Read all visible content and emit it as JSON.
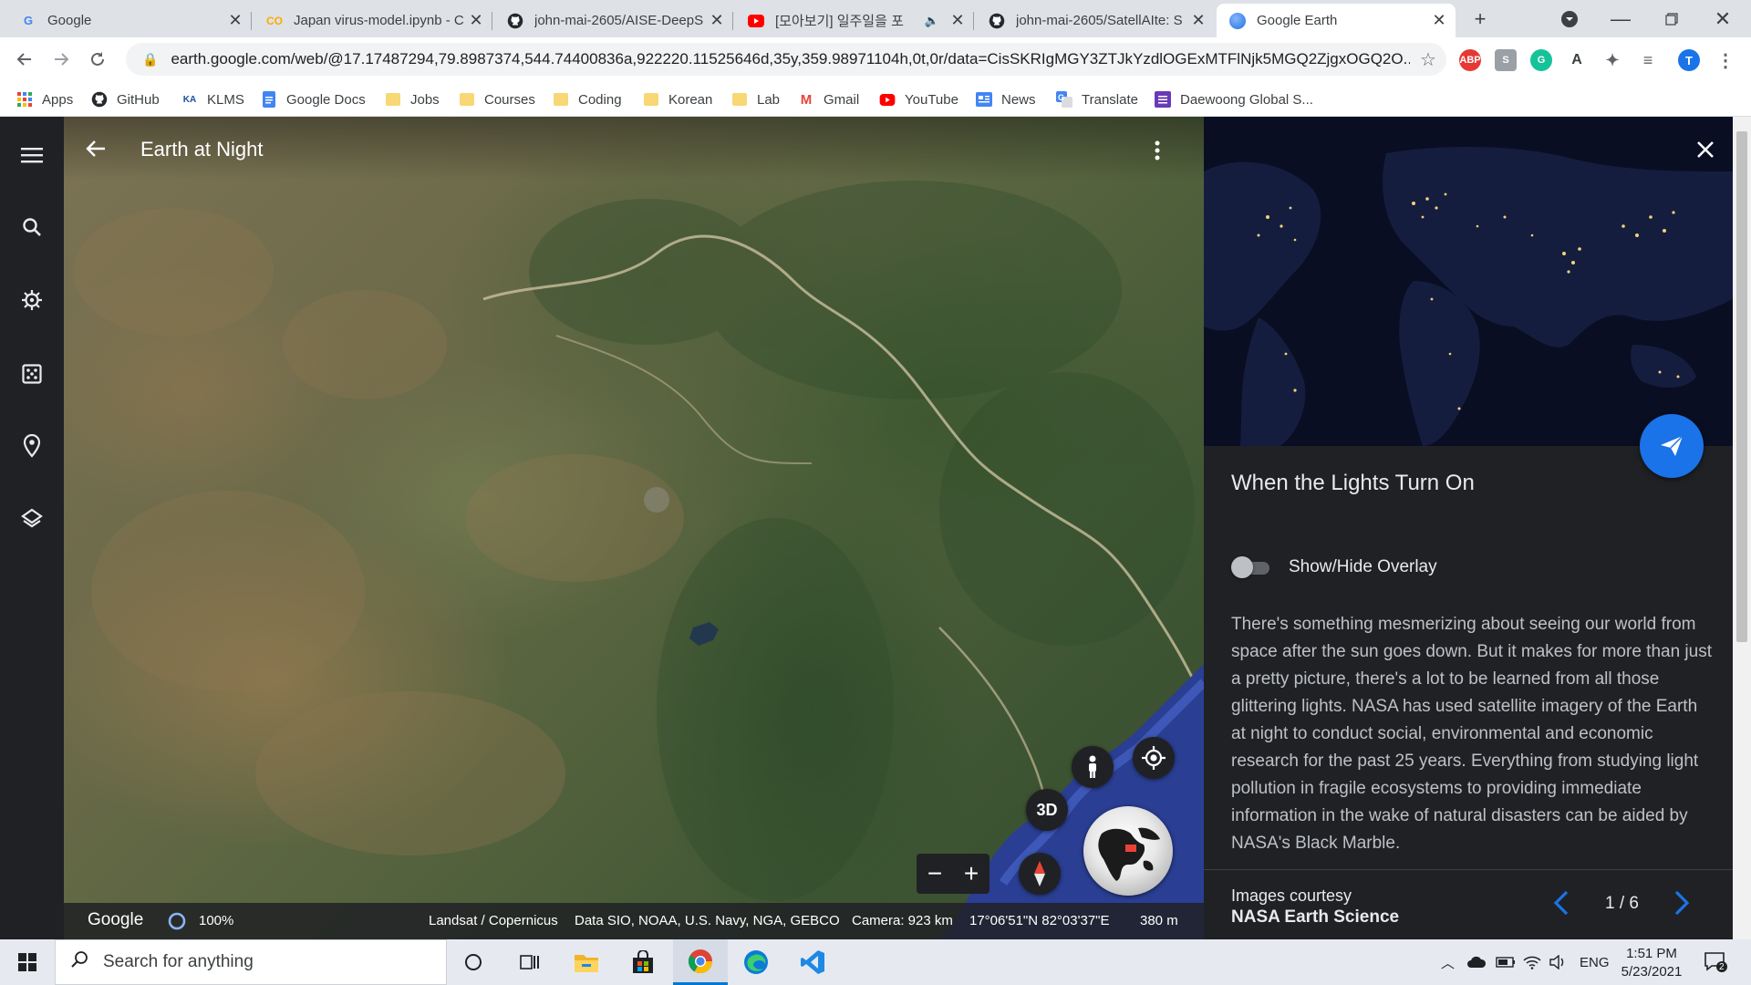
{
  "browser": {
    "tabs": [
      {
        "title": "Google",
        "favicon": "google-icon"
      },
      {
        "title": "Japan virus-model.ipynb - C",
        "favicon": "colab-icon"
      },
      {
        "title": "john-mai-2605/AISE-DeepS",
        "favicon": "github-icon"
      },
      {
        "title": "[모아보기] 일주일을 포",
        "favicon": "youtube-icon"
      },
      {
        "title": "john-mai-2605/SatellAIte: S",
        "favicon": "github-icon"
      },
      {
        "title": "Google Earth",
        "favicon": "google-earth-icon"
      }
    ],
    "new_tab": "+",
    "url": "earth.google.com/web/@17.17487294,79.8987374,544.74400836a,922220.11525646d,35y,359.98971104h,0t,0r/data=CisSKRIgMGY3ZTJkYzdlOGExMTFlNjk5MGQ2ZjgxOGQ2O...",
    "profile_initial": "T",
    "bookmarks": [
      "Apps",
      "GitHub",
      "KLMS",
      "Google Docs",
      "Jobs",
      "Courses",
      "Coding",
      "Korean",
      "Lab",
      "Gmail",
      "YouTube",
      "News",
      "Translate",
      "Daewoong Global S..."
    ]
  },
  "earth": {
    "tour_title": "Earth at Night",
    "controls": {
      "three_d": "3D"
    },
    "footer": {
      "logo": "Google",
      "load_percent": "100%",
      "imagery": "Landsat / Copernicus",
      "data": "Data SIO, NOAA, U.S. Navy, NGA, GEBCO",
      "camera": "Camera: 923 km",
      "coords": "17°06'51\"N 82°03'37\"E",
      "scale": "380 m"
    }
  },
  "panel": {
    "title": "When the Lights Turn On",
    "toggle_label": "Show/Hide Overlay",
    "toggle_on": false,
    "body": "There's something mesmerizing about seeing our world from space after the sun goes down. But it makes for more than just a pretty picture, there's a lot to be learned from all those glittering lights. NASA has used satellite imagery of the Earth at night to conduct social, environmental and economic research for the past 25 years. Everything from studying light pollution in fragile ecosystems to providing immediate information in the wake of natural disasters can be aided by NASA's Black Marble.",
    "credit_label": "Images courtesy",
    "credit_source": "NASA Earth Science",
    "page": "1 / 6"
  },
  "taskbar": {
    "search_placeholder": "Search for anything",
    "language": "ENG",
    "time": "1:51 PM",
    "date": "5/23/2021",
    "notification_count": "2"
  },
  "colors": {
    "accent": "#1a73e8",
    "panel_bg": "#202124",
    "chrome_tabbar": "#dee1e6",
    "taskbar": "#e6eaf0"
  }
}
